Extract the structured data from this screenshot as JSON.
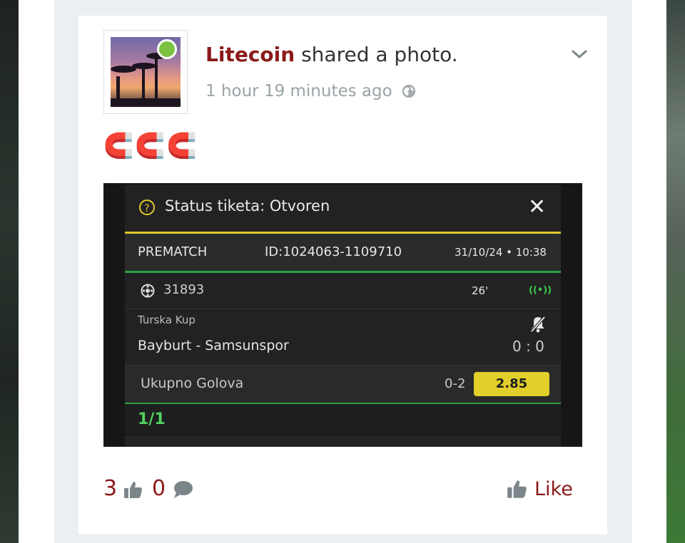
{
  "post": {
    "author": "Litecoin",
    "action": " shared a photo.",
    "time_ago": "1 hour 19 minutes ago",
    "message": "🧲🧲🧲"
  },
  "ticket": {
    "status": "Status tiketa: Otvoren",
    "type": "PREMATCH",
    "id": "ID:1024063-1109710",
    "datetime": "31/10/24 • 10:38",
    "event_code": "31893",
    "minute": "26'",
    "live_icon": "((•))",
    "league": "Turska Kup",
    "match": "Bayburt - Samsunspor",
    "score": "0 : 0",
    "market": "Ukupno Golova",
    "pick": "0-2",
    "odd": "2.85",
    "progress": "1/1"
  },
  "footer": {
    "likes_count": "3",
    "comments_count": "0",
    "like_label": "Like"
  },
  "colors": {
    "author": "#8b1a1a",
    "online": "#7cc242",
    "ticket_yellow": "#e2cf2a",
    "ticket_green": "#2aa24a"
  }
}
